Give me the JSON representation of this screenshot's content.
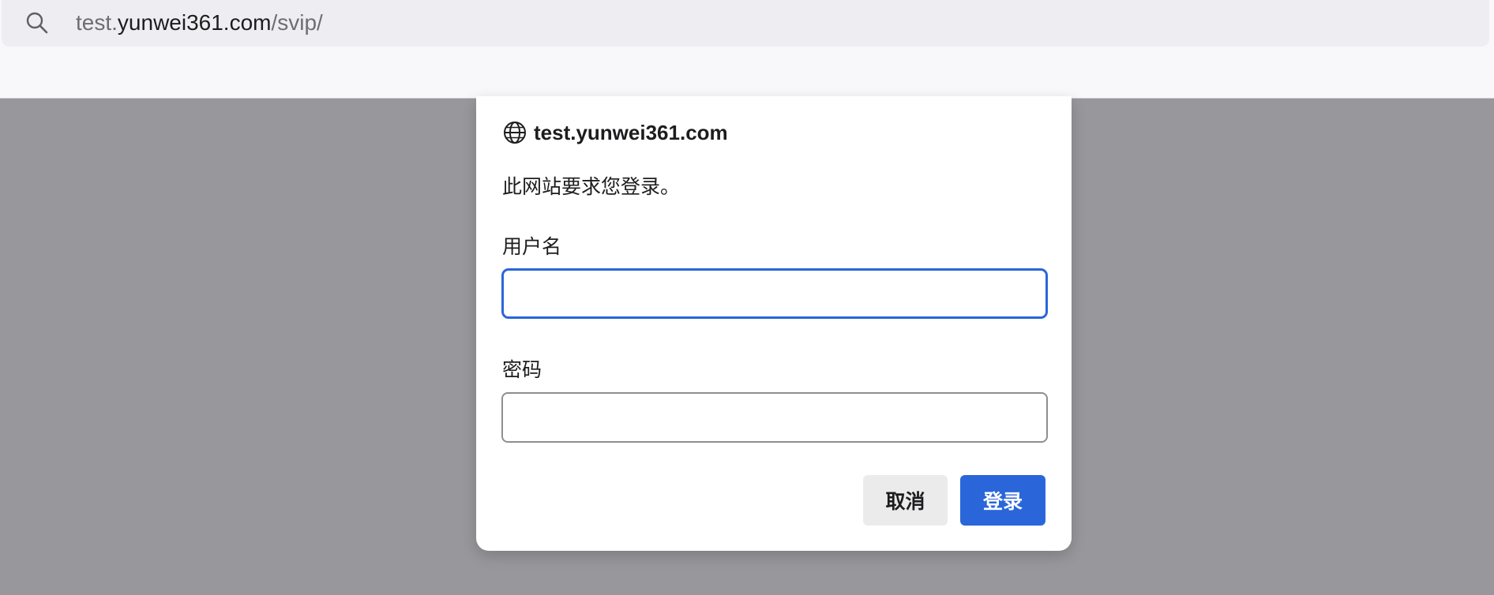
{
  "browser": {
    "url_prefix": "test.",
    "url_host": "yunwei361.com",
    "url_path": "/svip/",
    "search_icon": "search-icon"
  },
  "dialog": {
    "site_icon": "globe-icon",
    "site_name": "test.yunwei361.com",
    "prompt": "此网站要求您登录。",
    "username_label": "用户名",
    "username_value": "",
    "password_label": "密码",
    "password_value": "",
    "cancel_label": "取消",
    "login_label": "登录"
  },
  "colors": {
    "accent": "#2a66d9",
    "backdrop": "#98979c",
    "address_bar": "#eeeef2"
  }
}
